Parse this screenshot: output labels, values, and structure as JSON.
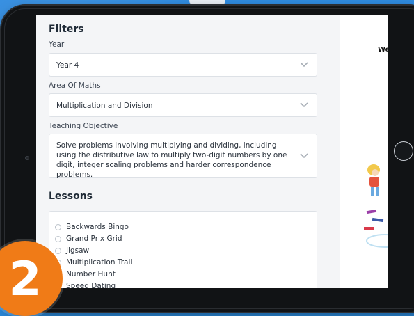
{
  "filters": {
    "title": "Filters",
    "year_label": "Year",
    "year_value": "Year 4",
    "area_label": "Area Of Maths",
    "area_value": "Multiplication and Division",
    "objective_label": "Teaching Objective",
    "objective_value": "Solve problems involving multiplying and dividing, including using the distributive law to multiply two-digit numbers by one digit, integer scaling problems and harder correspondence problems."
  },
  "lessons": {
    "title": "Lessons",
    "items": [
      {
        "label": "Backwards Bingo"
      },
      {
        "label": "Grand Prix Grid"
      },
      {
        "label": "Jigsaw"
      },
      {
        "label": "Multiplication Trail"
      },
      {
        "label": "Number Hunt"
      },
      {
        "label": "Speed Dating"
      }
    ]
  },
  "right_panel": {
    "heading_fragment": "We"
  },
  "badge": {
    "number": "2",
    "color": "#f07b17"
  },
  "colors": {
    "background": "#2f8be0",
    "bezel": "#111315",
    "panel": "#f4f5f7"
  }
}
